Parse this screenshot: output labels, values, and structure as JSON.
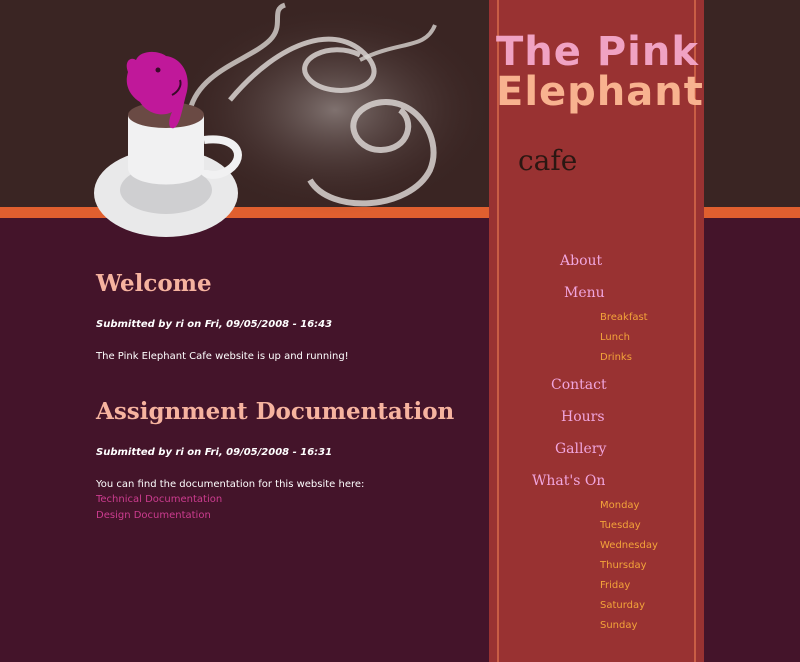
{
  "site": {
    "title_line1": "The Pink",
    "title_line2": "Elephant",
    "subtitle": "cafe"
  },
  "colors": {
    "header_bg": "#3a2523",
    "main_bg": "#44142a",
    "nav_bg": "#993232",
    "accent_orange": "#e05f2f",
    "link": "#cc3c8f",
    "submenu": "#f3a33a",
    "menu": "#f0a5dd"
  },
  "posts": [
    {
      "title": "Welcome",
      "meta": "Submitted by ri on Fri, 09/05/2008 - 16:43",
      "body": "The Pink Elephant Cafe website is up and running!"
    },
    {
      "title": "Assignment Documentation",
      "meta": "Submitted by ri on Fri, 09/05/2008 - 16:31",
      "body": "You can find the documentation for this website here:",
      "links": [
        "Technical Documentation",
        "Design Documentation"
      ]
    }
  ],
  "nav": {
    "about": "About",
    "menu": "Menu",
    "menu_sub": [
      "Breakfast",
      "Lunch",
      "Drinks"
    ],
    "contact": "Contact",
    "hours": "Hours",
    "gallery": "Gallery",
    "whats_on": "What's On",
    "whats_on_sub": [
      "Monday",
      "Tuesday",
      "Wednesday",
      "Thursday",
      "Friday",
      "Saturday",
      "Sunday"
    ]
  }
}
